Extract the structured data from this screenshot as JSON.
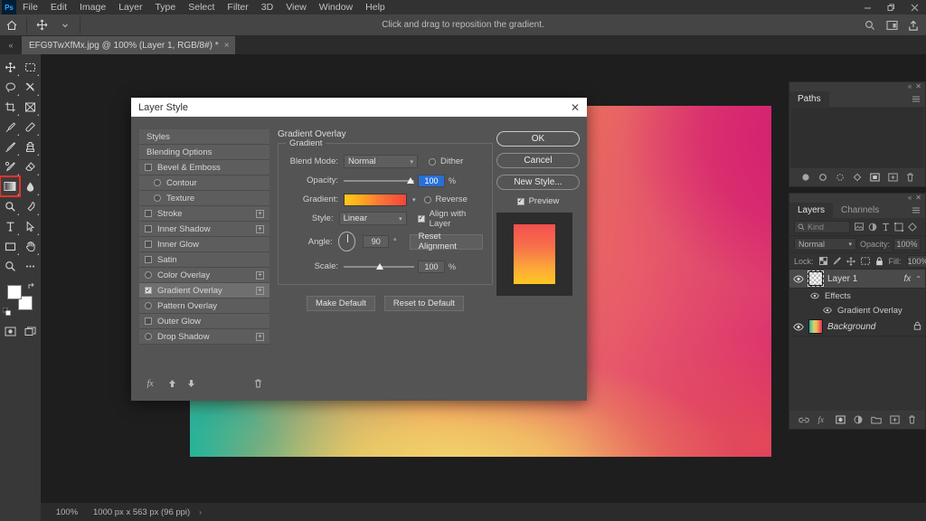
{
  "app": {
    "logo": "Ps",
    "menus": [
      "File",
      "Edit",
      "Image",
      "Layer",
      "Type",
      "Select",
      "Filter",
      "3D",
      "View",
      "Window",
      "Help"
    ],
    "window_controls": [
      "minimize",
      "restore",
      "close"
    ]
  },
  "options_bar": {
    "hint": "Click and drag to reposition the gradient.",
    "home_icon": "home-icon",
    "tool_icon": "move-tool-icon",
    "right_icons": [
      "search-icon",
      "workspace-icon",
      "share-icon"
    ]
  },
  "tab_bar": {
    "collapse": "«",
    "document_title": "EFG9TwXfMx.jpg @ 100% (Layer 1, RGB/8#) *",
    "close": "×"
  },
  "toolbar": {
    "tools": [
      {
        "name": "move-tool",
        "glyph": "move"
      },
      {
        "name": "rectangular-marquee-tool",
        "glyph": "marquee"
      },
      {
        "name": "lasso-tool",
        "glyph": "lasso"
      },
      {
        "name": "object-selection-tool",
        "glyph": "wand"
      },
      {
        "name": "crop-tool",
        "glyph": "crop"
      },
      {
        "name": "frame-tool",
        "glyph": "frame"
      },
      {
        "name": "eyedropper-tool",
        "glyph": "eyedropper"
      },
      {
        "name": "spot-healing-brush-tool",
        "glyph": "healing"
      },
      {
        "name": "brush-tool",
        "glyph": "brush"
      },
      {
        "name": "clone-stamp-tool",
        "glyph": "stamp"
      },
      {
        "name": "history-brush-tool",
        "glyph": "historybrush"
      },
      {
        "name": "eraser-tool",
        "glyph": "eraser"
      },
      {
        "name": "gradient-tool",
        "glyph": "gradient",
        "selected": true
      },
      {
        "name": "blur-tool",
        "glyph": "blur"
      },
      {
        "name": "dodge-tool",
        "glyph": "dodge"
      },
      {
        "name": "pen-tool",
        "glyph": "pen"
      },
      {
        "name": "type-tool",
        "glyph": "type"
      },
      {
        "name": "path-selection-tool",
        "glyph": "arrow"
      },
      {
        "name": "rectangle-tool",
        "glyph": "rectangle"
      },
      {
        "name": "hand-tool",
        "glyph": "hand"
      },
      {
        "name": "zoom-tool",
        "glyph": "zoom"
      },
      {
        "name": "edit-toolbar",
        "glyph": "dots"
      }
    ],
    "foreground_color": "#ffffff",
    "background_color": "#ffffff",
    "selected_tool_outline": "#e8322a"
  },
  "canvas": {
    "document_colors": {
      "top_left": "#f08a4a",
      "top_right": "#d82a6e",
      "bottom_left": "#1fb6a0",
      "bottom_mid": "#ecd87a",
      "bottom_right": "#e8614d",
      "center": "#ef8b55"
    }
  },
  "dialog": {
    "title": "Layer Style",
    "close": "✕",
    "styles": [
      {
        "label": "Styles",
        "type": "plain"
      },
      {
        "label": "Blending Options",
        "type": "plain"
      },
      {
        "label": "Bevel & Emboss",
        "type": "check",
        "checked": false,
        "plus": false
      },
      {
        "label": "Contour",
        "type": "check",
        "checked": false,
        "indent": true,
        "round": true
      },
      {
        "label": "Texture",
        "type": "check",
        "checked": false,
        "indent": true,
        "round": true
      },
      {
        "label": "Stroke",
        "type": "check",
        "checked": false,
        "plus": true
      },
      {
        "label": "Inner Shadow",
        "type": "check",
        "checked": false,
        "plus": true
      },
      {
        "label": "Inner Glow",
        "type": "check",
        "checked": false
      },
      {
        "label": "Satin",
        "type": "check",
        "checked": false
      },
      {
        "label": "Color Overlay",
        "type": "check",
        "checked": false,
        "plus": true
      },
      {
        "label": "Gradient Overlay",
        "type": "check",
        "checked": true,
        "plus": true,
        "selected": true
      },
      {
        "label": "Pattern Overlay",
        "type": "check",
        "checked": false
      },
      {
        "label": "Outer Glow",
        "type": "check",
        "checked": false
      },
      {
        "label": "Drop Shadow",
        "type": "check",
        "checked": false,
        "plus": true
      }
    ],
    "styles_footer_icons": [
      "fx-icon",
      "move-up-icon",
      "move-down-icon",
      "trash-icon"
    ],
    "section_title": "Gradient Overlay",
    "fieldset_legend": "Gradient",
    "fields": {
      "blend_mode_label": "Blend Mode:",
      "blend_mode_value": "Normal",
      "dither_label": "Dither",
      "dither_checked": false,
      "opacity_label": "Opacity:",
      "opacity_value": "100",
      "opacity_unit": "%",
      "gradient_label": "Gradient:",
      "gradient_stops": [
        "#ffc81e",
        "#ffb01c",
        "#fa7a35",
        "#f5453a"
      ],
      "reverse_label": "Reverse",
      "reverse_checked": false,
      "style_label": "Style:",
      "style_value": "Linear",
      "align_label": "Align with Layer",
      "align_checked": true,
      "angle_label": "Angle:",
      "angle_value": "90",
      "angle_unit": "°",
      "reset_alignment": "Reset Alignment",
      "scale_label": "Scale:",
      "scale_value": "100",
      "scale_unit": "%"
    },
    "make_default": "Make Default",
    "reset_to_default": "Reset to Default",
    "ok": "OK",
    "cancel": "Cancel",
    "new_style": "New Style...",
    "preview_label": "Preview",
    "preview_checked": true,
    "preview_gradient": [
      "#f4504f",
      "#f7714a",
      "#fca63a",
      "#ffc71f"
    ]
  },
  "paths_panel": {
    "tab": "Paths",
    "menu_icon": "panel-menu-icon",
    "footer_icons": [
      "fill-path-icon",
      "stroke-path-icon",
      "load-selection-icon",
      "make-work-path-icon",
      "add-mask-icon",
      "new-path-icon",
      "delete-path-icon"
    ]
  },
  "layers_panel": {
    "tabs": [
      {
        "label": "Layers",
        "active": true
      },
      {
        "label": "Channels",
        "active": false
      }
    ],
    "menu_icon": "panel-menu-icon",
    "filter_placeholder": "Kind",
    "filter_icons": [
      "pixel-filter-icon",
      "adjustment-filter-icon",
      "type-filter-icon",
      "shape-filter-icon",
      "smartobject-filter-icon"
    ],
    "blend_mode": "Normal",
    "opacity_label": "Opacity:",
    "opacity_value": "100%",
    "lock_label": "Lock:",
    "lock_icons": [
      "lock-transparent-icon",
      "lock-image-icon",
      "lock-position-icon",
      "lock-artboard-icon",
      "lock-all-icon"
    ],
    "fill_label": "Fill:",
    "fill_value": "100%",
    "layers": [
      {
        "name": "Layer 1",
        "selected": true,
        "visible": true,
        "thumb": "checker",
        "fx": "fx",
        "expand": "⌃",
        "effects": [
          {
            "name": "Effects"
          },
          {
            "name": "Gradient Overlay"
          }
        ]
      },
      {
        "name": "Background",
        "selected": false,
        "visible": true,
        "thumb": "gradient",
        "italic": true,
        "locked": true
      }
    ],
    "footer_icons": [
      "link-icon",
      "fx-icon",
      "mask-icon",
      "adjustment-icon",
      "group-icon",
      "new-layer-icon",
      "trash-icon"
    ]
  },
  "status_bar": {
    "zoom": "100%",
    "doc_info": "1000 px x 563 px (96 ppi)",
    "arrow": "›"
  }
}
